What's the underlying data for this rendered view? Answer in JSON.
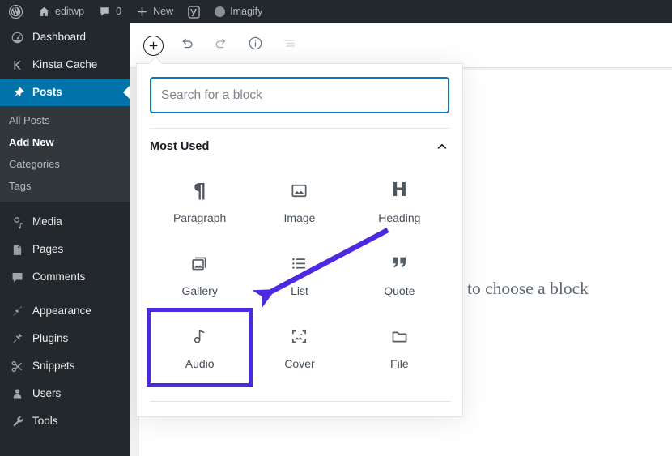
{
  "adminbar": {
    "wp_logo": "wordpress-logo",
    "site_name": "editwp",
    "comment_count": "0",
    "new_label": "New",
    "yoast_label": "yoast-icon",
    "imagify_label": "Imagify"
  },
  "sidebar": {
    "items": [
      {
        "label": "Dashboard",
        "icon": "dashboard-icon",
        "current": false
      },
      {
        "label": "Kinsta Cache",
        "icon": "kinsta-icon",
        "current": false
      },
      {
        "label": "Posts",
        "icon": "pin-icon",
        "current": true
      },
      {
        "label": "Media",
        "icon": "media-icon",
        "current": false
      },
      {
        "label": "Pages",
        "icon": "pages-icon",
        "current": false
      },
      {
        "label": "Comments",
        "icon": "comments-icon",
        "current": false
      },
      {
        "label": "Appearance",
        "icon": "appearance-icon",
        "current": false
      },
      {
        "label": "Plugins",
        "icon": "plugins-icon",
        "current": false
      },
      {
        "label": "Snippets",
        "icon": "snippets-icon",
        "current": false
      },
      {
        "label": "Users",
        "icon": "users-icon",
        "current": false
      },
      {
        "label": "Tools",
        "icon": "tools-icon",
        "current": false
      }
    ],
    "posts_submenu": [
      {
        "label": "All Posts",
        "current": false
      },
      {
        "label": "Add New",
        "current": true
      },
      {
        "label": "Categories",
        "current": false
      },
      {
        "label": "Tags",
        "current": false
      }
    ]
  },
  "toolbar": {
    "inserter_label": "add-block-inserter",
    "undo_label": "undo",
    "redo_label": "redo",
    "info_label": "content-structure-info",
    "listview_label": "block-navigation"
  },
  "canvas": {
    "ghost_text": "to choose a block"
  },
  "inserter": {
    "search": {
      "value": "",
      "placeholder": "Search for a block"
    },
    "section": {
      "title": "Most Used",
      "collapse_icon": "chevron-up-icon",
      "expanded": true
    },
    "blocks": [
      {
        "label": "Paragraph",
        "icon": "paragraph-icon",
        "highlighted": false
      },
      {
        "label": "Image",
        "icon": "image-icon",
        "highlighted": false
      },
      {
        "label": "Heading",
        "icon": "heading-icon",
        "highlighted": false
      },
      {
        "label": "Gallery",
        "icon": "gallery-icon",
        "highlighted": false
      },
      {
        "label": "List",
        "icon": "list-icon",
        "highlighted": false
      },
      {
        "label": "Quote",
        "icon": "quote-icon",
        "highlighted": false
      },
      {
        "label": "Audio",
        "icon": "audio-icon",
        "highlighted": true
      },
      {
        "label": "Cover",
        "icon": "cover-icon",
        "highlighted": false
      },
      {
        "label": "File",
        "icon": "file-icon",
        "highlighted": false
      }
    ]
  },
  "annotation": {
    "arrow_color": "#4d29df",
    "highlight_color": "#4d29df",
    "arrow_target": "List"
  },
  "colors": {
    "sidebar_bg": "#23282d",
    "submenu_bg": "#32373c",
    "accent_blue": "#0073aa",
    "focus_blue": "#007cba"
  }
}
